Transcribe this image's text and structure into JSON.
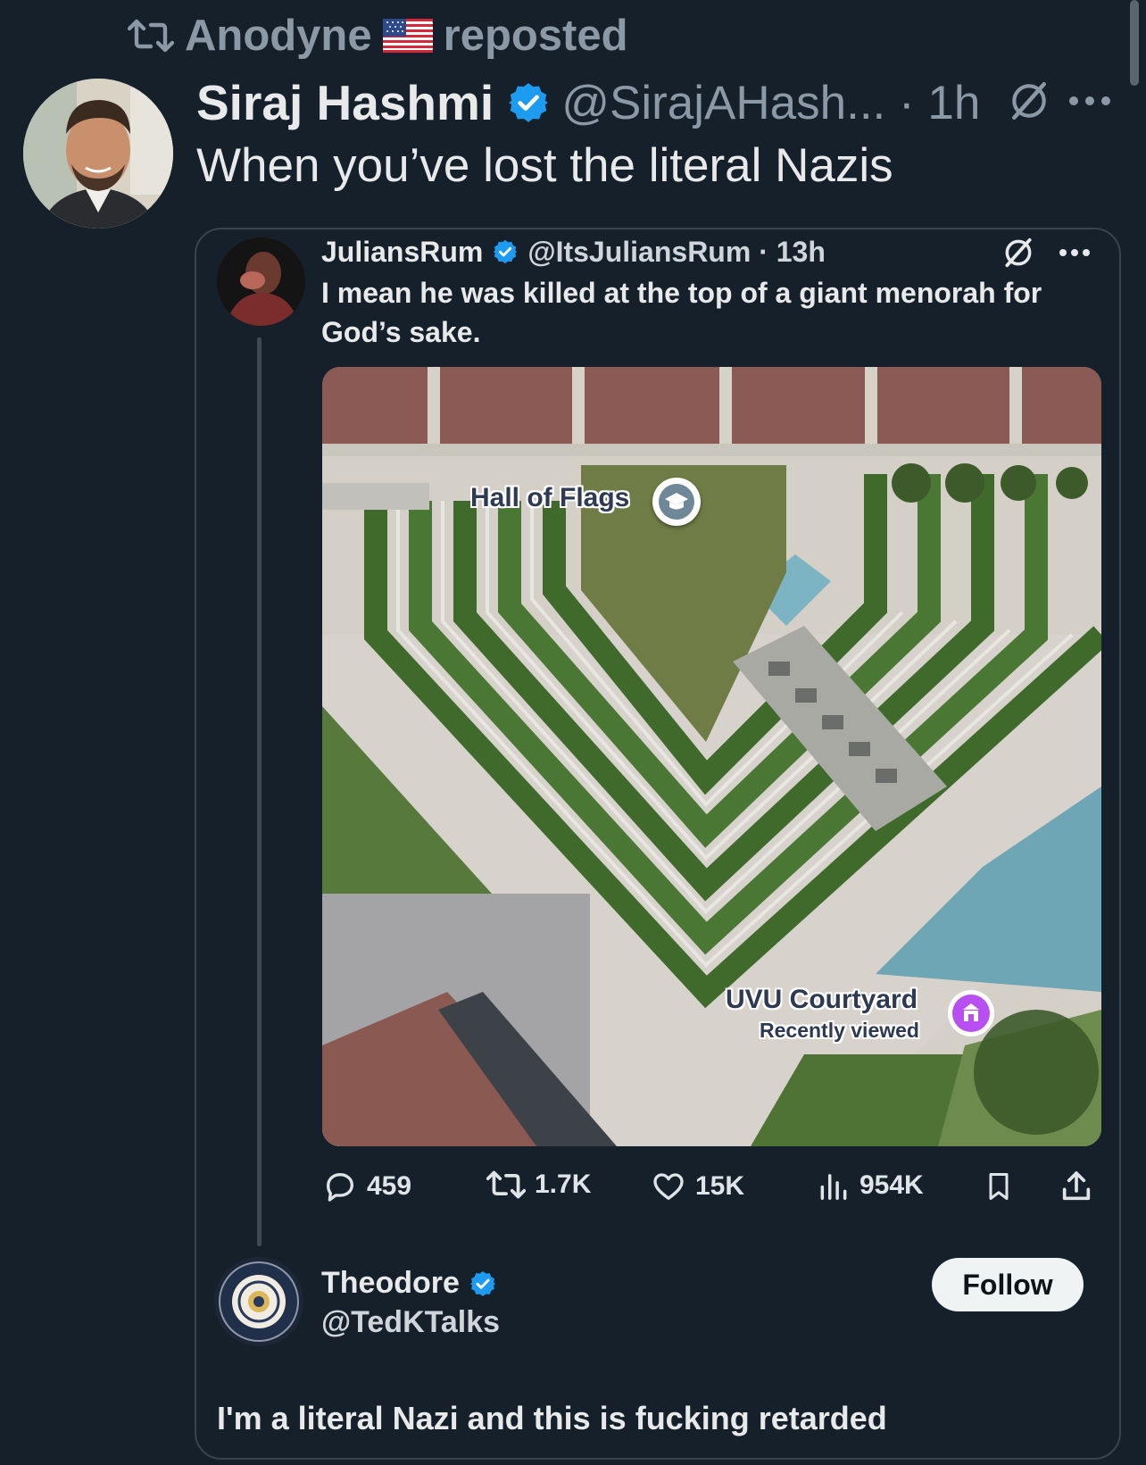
{
  "repost": {
    "reposter": "Anodyne",
    "suffix": "reposted",
    "icons": [
      "repost-icon",
      "us-flag-icon"
    ]
  },
  "main_tweet": {
    "name": "Siraj Hashmi",
    "handle_time": "@SirajAHash... · 1h",
    "text": "When you’ve lost the literal Nazis",
    "icons": [
      "verified-badge-icon",
      "grok-icon",
      "more-icon"
    ]
  },
  "quoted_tweet": {
    "name": "JuliansRum",
    "handle_time": "@ItsJuliansRum · 13h",
    "text": "I mean he was killed at the top of a giant menorah for God’s sake.",
    "map": {
      "label_hall": "Hall of Flags",
      "label_uvu": "UVU Courtyard",
      "label_recent": "Recently viewed",
      "icons": [
        "graduation-cap-icon",
        "museum-icon"
      ]
    },
    "actions": {
      "replies": "459",
      "reposts": "1.7K",
      "likes": "15K",
      "views": "954K"
    }
  },
  "reply": {
    "name": "Theodore",
    "handle": "@TedKTalks",
    "follow_label": "Follow",
    "text": "I'm a literal Nazi and this is fucking retarded"
  },
  "colors": {
    "background": "#16202b",
    "text": "#e7e9ea",
    "muted": "#8b98a5",
    "verified": "#1d9bf0",
    "border": "#38444d",
    "follow_bg": "#eff3f4"
  }
}
